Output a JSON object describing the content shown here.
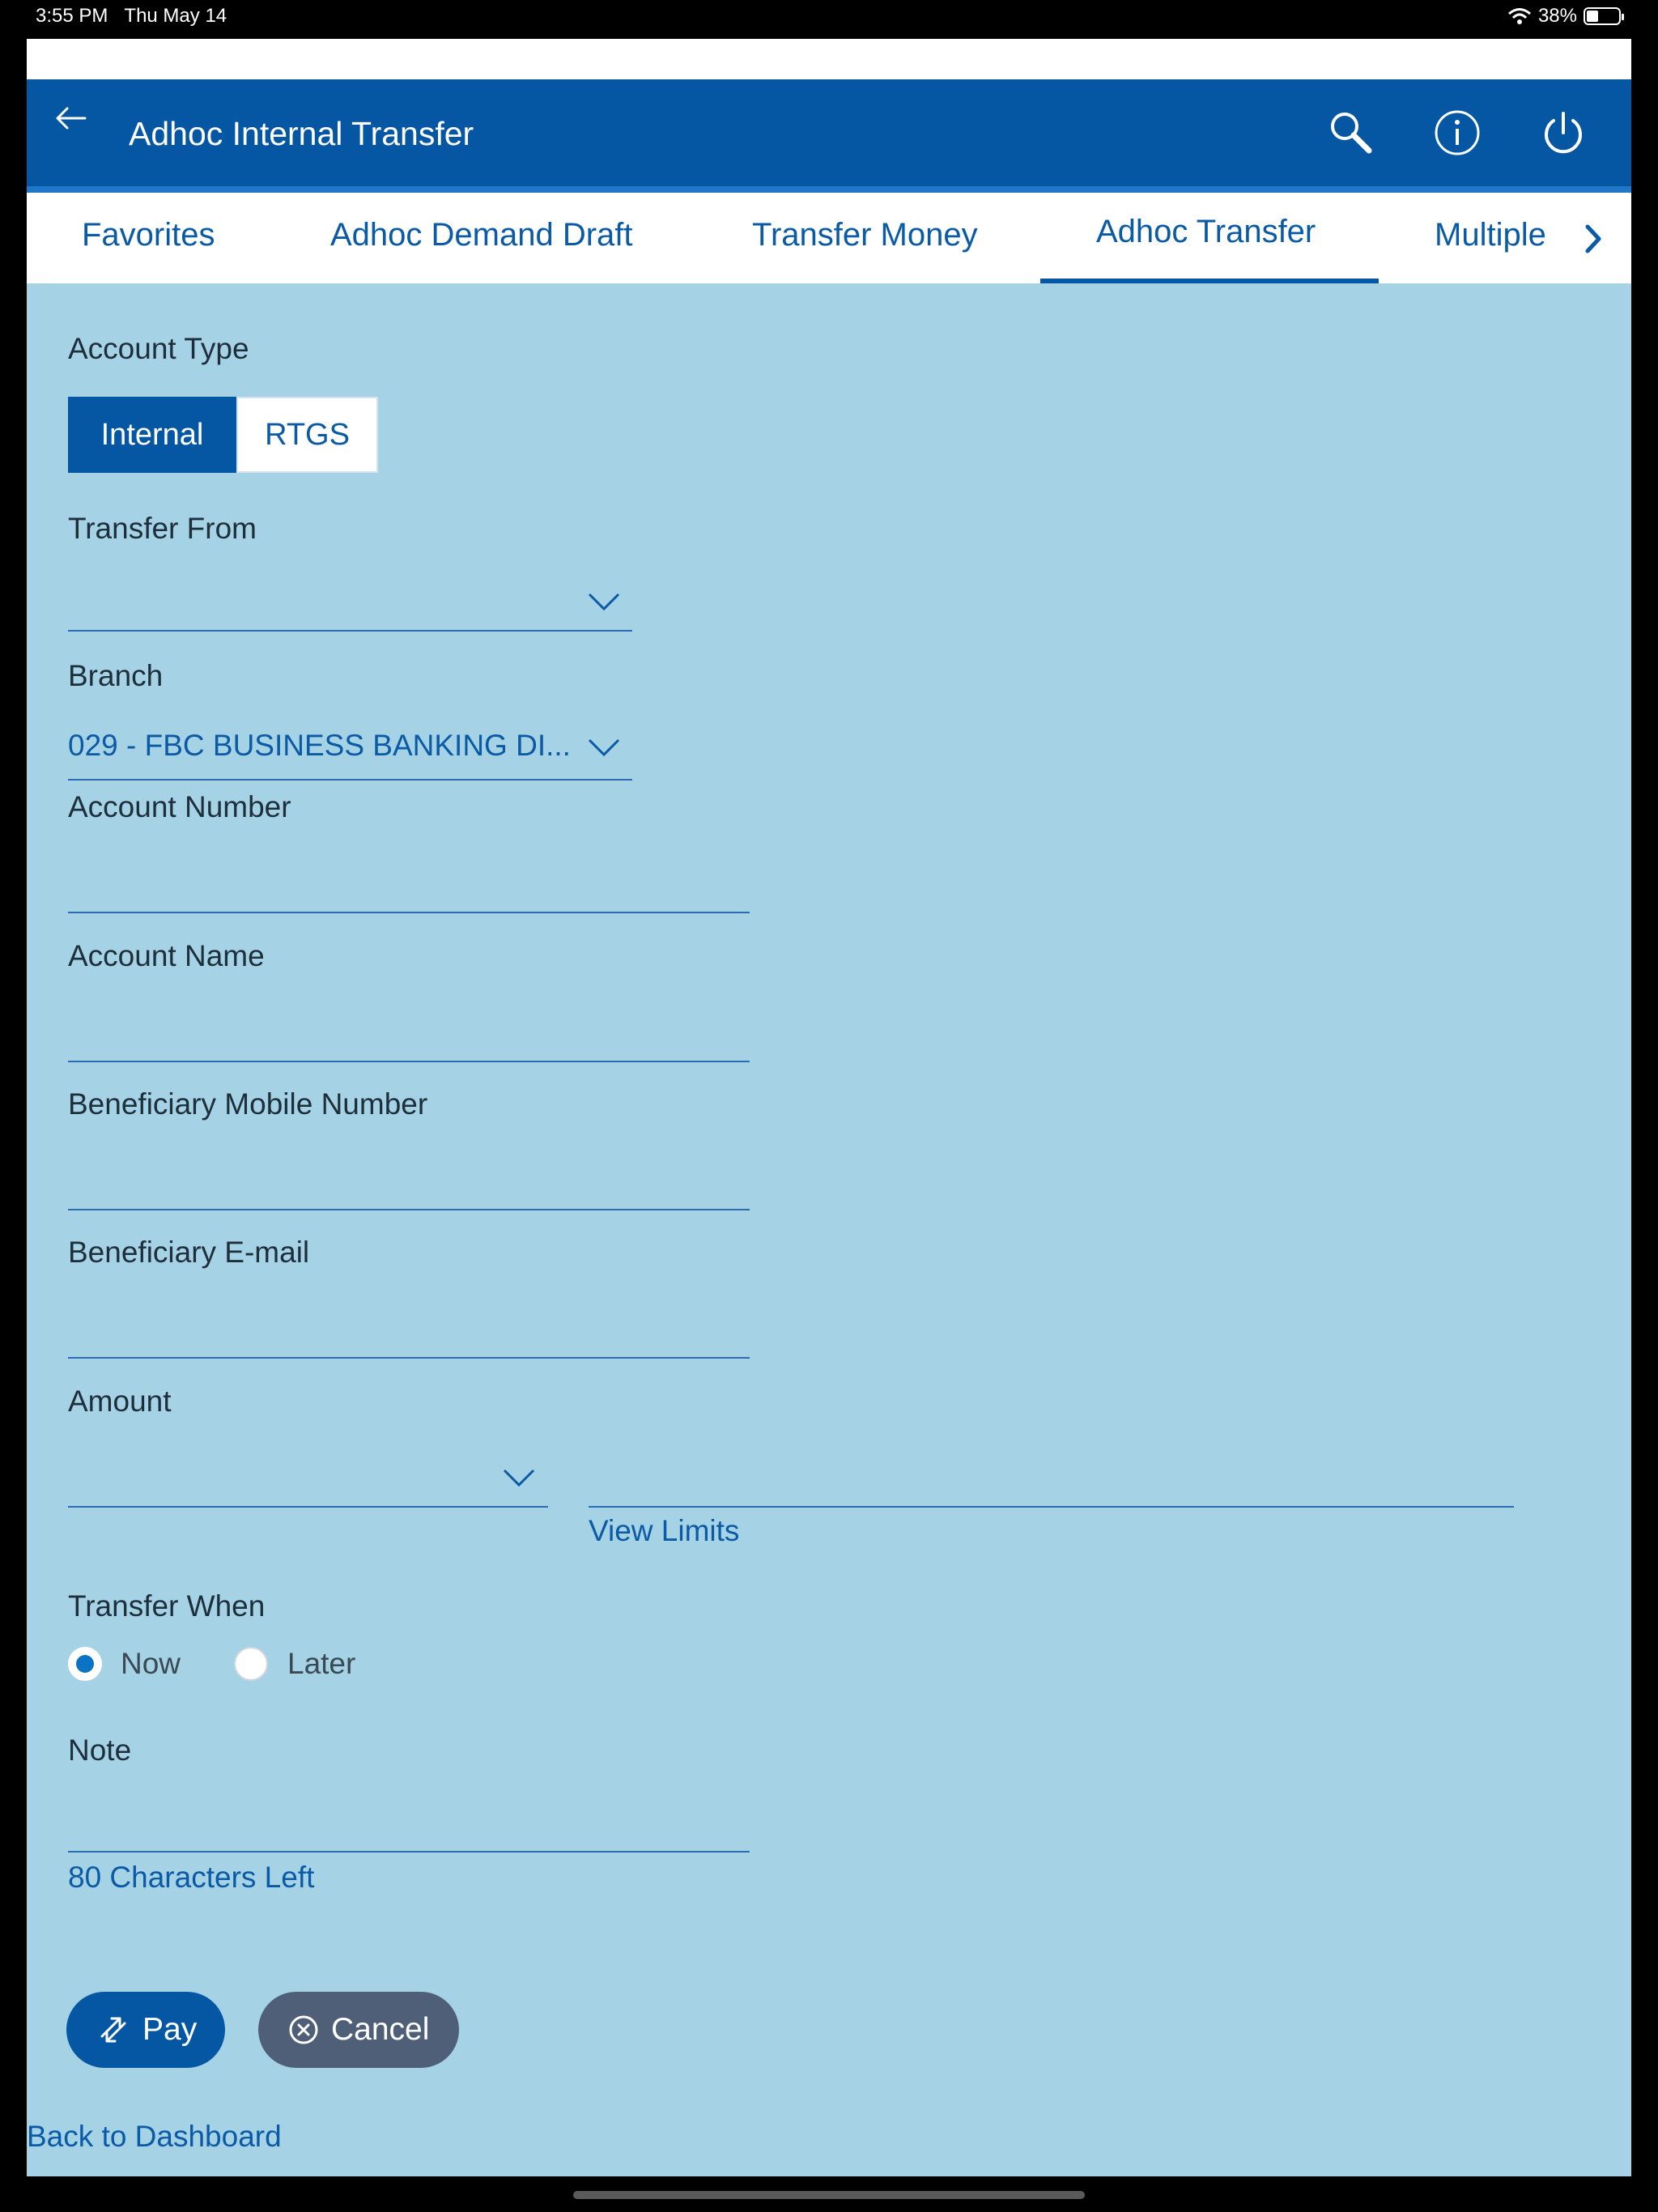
{
  "status_bar": {
    "time": "3:55 PM",
    "date": "Thu May 14",
    "battery": "38%",
    "icons": [
      "wifi-icon",
      "battery-icon"
    ]
  },
  "header": {
    "title": "Adhoc Internal Transfer",
    "icons": [
      "back-arrow-icon",
      "search-icon",
      "info-icon",
      "power-icon"
    ]
  },
  "tabs": [
    {
      "label": "Favorites"
    },
    {
      "label": "Adhoc Demand Draft"
    },
    {
      "label": "Transfer Money"
    },
    {
      "label": "Adhoc Transfer",
      "active": true
    },
    {
      "label": "Multiple"
    }
  ],
  "form": {
    "account_type": {
      "label": "Account Type",
      "options": [
        "Internal",
        "RTGS"
      ],
      "selected": "Internal"
    },
    "transfer_from": {
      "label": "Transfer From",
      "value": ""
    },
    "branch": {
      "label": "Branch",
      "value": "029 - FBC BUSINESS BANKING DI..."
    },
    "account_number": {
      "label": "Account Number",
      "value": ""
    },
    "account_name": {
      "label": "Account Name",
      "value": ""
    },
    "beneficiary_mobile": {
      "label": "Beneficiary Mobile Number",
      "value": ""
    },
    "beneficiary_email": {
      "label": "Beneficiary E-mail",
      "value": ""
    },
    "amount": {
      "label": "Amount",
      "currency": "",
      "value": "",
      "view_limits": "View Limits"
    },
    "transfer_when": {
      "label": "Transfer When",
      "options": [
        "Now",
        "Later"
      ],
      "selected": "Now"
    },
    "note": {
      "label": "Note",
      "value": "",
      "chars_left": "80 Characters Left"
    }
  },
  "actions": {
    "pay": "Pay",
    "cancel": "Cancel"
  },
  "footer": {
    "back_link": "Back to Dashboard"
  },
  "colors": {
    "primary": "#0557a4",
    "background": "#a6d2e5",
    "cancel": "#4f5f78",
    "link": "#0a5aa6"
  }
}
